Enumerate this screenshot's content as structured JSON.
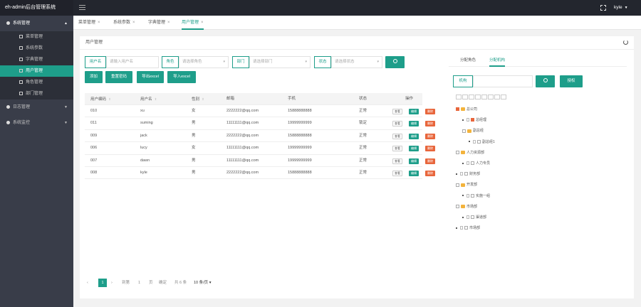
{
  "app": {
    "title": "eh-admin后台管理系统",
    "user": "kyle"
  },
  "sidebar": {
    "groups": [
      {
        "label": "系统管理",
        "open": true,
        "items": [
          {
            "label": "菜单管理"
          },
          {
            "label": "系统参数"
          },
          {
            "label": "字典管理"
          },
          {
            "label": "用户管理",
            "active": true
          },
          {
            "label": "角色管理"
          },
          {
            "label": "部门管理"
          }
        ]
      },
      {
        "label": "日志管理"
      },
      {
        "label": "系统监控"
      }
    ]
  },
  "tabs": [
    {
      "label": "菜单管理"
    },
    {
      "label": "系统参数"
    },
    {
      "label": "字典管理"
    },
    {
      "label": "用户管理",
      "active": true
    }
  ],
  "card": {
    "title": "用户管理"
  },
  "filters": {
    "username": {
      "label": "用户名",
      "placeholder": "请输入用户名"
    },
    "role": {
      "label": "角色",
      "placeholder": "请选择角色"
    },
    "dept": {
      "label": "部门",
      "placeholder": "请选择部门"
    },
    "status": {
      "label": "状态",
      "placeholder": "请选择状态"
    }
  },
  "actions": {
    "add": "添加",
    "reset_pwd": "重置密码",
    "export": "导出excel",
    "import": "导入excel"
  },
  "table": {
    "columns": [
      "用户编码",
      "用户名",
      "性别",
      "邮箱",
      "手机",
      "状态",
      "操作"
    ],
    "row_buttons": {
      "view": "查看",
      "edit": "编辑",
      "delete": "删除"
    },
    "rows": [
      {
        "code": "010",
        "name": "xu",
        "gender": "女",
        "email": "2222222@qq.com",
        "phone": "15888888888",
        "status": "正常"
      },
      {
        "code": "011",
        "name": "suming",
        "gender": "男",
        "email": "11111111@qq.com",
        "phone": "19999999999",
        "status": "锁定"
      },
      {
        "code": "009",
        "name": "jack",
        "gender": "男",
        "email": "2222222@qq.com",
        "phone": "15888888888",
        "status": "正常"
      },
      {
        "code": "006",
        "name": "lucy",
        "gender": "女",
        "email": "11111111@qq.com",
        "phone": "19999999999",
        "status": "正常"
      },
      {
        "code": "007",
        "name": "dawn",
        "gender": "男",
        "email": "11111111@qq.com",
        "phone": "19999999999",
        "status": "正常"
      },
      {
        "code": "008",
        "name": "kyle",
        "gender": "男",
        "email": "2222222@qq.com",
        "phone": "15888888888",
        "status": "正常"
      }
    ]
  },
  "pagination": {
    "current": "1",
    "goto_label": "到第",
    "goto_value": "1",
    "page_unit": "页",
    "confirm": "确定",
    "total": "共 6 条",
    "page_size": "10 条/页"
  },
  "right_panel": {
    "tabs": [
      {
        "label": "分配角色"
      },
      {
        "label": "分配机构",
        "active": true
      }
    ],
    "search_label": "机构",
    "authorize": "授权",
    "tree": [
      {
        "label": "总公司",
        "level": 0,
        "kind": "folder",
        "checked": true
      },
      {
        "label": "总经理",
        "level": 1,
        "kind": "dot",
        "checked": true
      },
      {
        "label": "副总经",
        "level": 1,
        "kind": "folder"
      },
      {
        "label": "副总经1",
        "level": 2,
        "kind": "dot"
      },
      {
        "label": "人力资源部",
        "level": 0,
        "kind": "folder"
      },
      {
        "label": "人力专员",
        "level": 1,
        "kind": "dot"
      },
      {
        "label": "财务部",
        "level": 0,
        "kind": "dot"
      },
      {
        "label": "开发部",
        "level": 0,
        "kind": "folder"
      },
      {
        "label": "实施一组",
        "level": 1,
        "kind": "dot"
      },
      {
        "label": "市场部",
        "level": 0,
        "kind": "folder"
      },
      {
        "label": "渠道部",
        "level": 1,
        "kind": "dot"
      },
      {
        "label": "市场部",
        "level": 0,
        "kind": "dot"
      }
    ]
  }
}
